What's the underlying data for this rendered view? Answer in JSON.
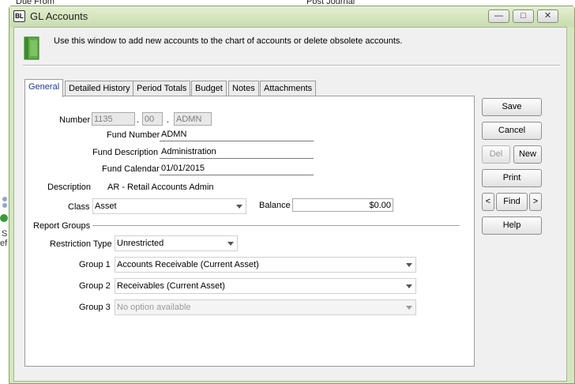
{
  "background": {
    "top_texts": [
      "Due From",
      "Post Journal"
    ],
    "left_fragments": [
      "S",
      "ef"
    ]
  },
  "window": {
    "app_badge": "BL",
    "title": "GL Accounts",
    "controls": {
      "minimize": "—",
      "maximize": "□",
      "close": "✕"
    }
  },
  "header": {
    "icon": "green-book-icon",
    "info": "Use this window to add new accounts to the chart of accounts or delete obsolete accounts."
  },
  "tabs": [
    {
      "label": "General",
      "active": true
    },
    {
      "label": "Detailed History",
      "active": false
    },
    {
      "label": "Period Totals",
      "active": false
    },
    {
      "label": "Budget",
      "active": false
    },
    {
      "label": "Notes",
      "active": false
    },
    {
      "label": "Attachments",
      "active": false
    }
  ],
  "general": {
    "number_label": "Number",
    "number_parts": [
      "1135",
      "00",
      "ADMN"
    ],
    "separator": ".",
    "fund_number_label": "Fund Number",
    "fund_number": "ADMN",
    "fund_description_label": "Fund Description",
    "fund_description": "Administration",
    "fund_calendar_label": "Fund Calendar",
    "fund_calendar": "01/01/2015",
    "description_label": "Description",
    "description": "AR - Retail  Accounts  Admin",
    "class_label": "Class",
    "class_value": "Asset",
    "balance_label": "Balance",
    "balance_value": "$0.00",
    "report_groups_label": "Report Groups",
    "restriction_type_label": "Restriction Type",
    "restriction_type": "Unrestricted",
    "group1_label": "Group 1",
    "group1": "Accounts Receivable (Current Asset)",
    "group2_label": "Group 2",
    "group2": "Receivables (Current Asset)",
    "group3_label": "Group 3",
    "group3": "No option available"
  },
  "buttons": {
    "save": "Save",
    "cancel": "Cancel",
    "del": "Del",
    "new": "New",
    "print": "Print",
    "prev": "<",
    "find": "Find",
    "next": ">",
    "help": "Help"
  },
  "colors": {
    "window_frame": "#d5e6bf",
    "active_tab_text": "#1a3a9a",
    "client_bg": "#f0f0f0"
  }
}
